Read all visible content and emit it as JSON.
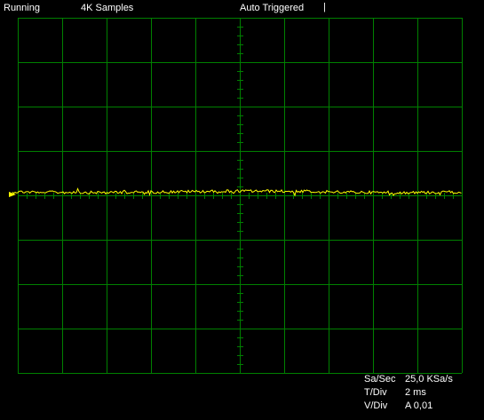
{
  "status_bar": {
    "run_state": "Running",
    "samples": "4K Samples",
    "trigger_mode": "Auto Triggered",
    "trigger_marker": "|"
  },
  "readouts": {
    "sample_rate_label": "Sa/Sec",
    "sample_rate_value": "25,0 KSa/s",
    "time_div_label": "T/Div",
    "time_div_value": "2 ms",
    "volt_div_label": "V/Div",
    "volt_div_value": "A 0,01"
  },
  "colors": {
    "background": "#000000",
    "grid": "#008000",
    "trace": "#ffff00",
    "text": "#ffffff"
  },
  "icons": {
    "trigger_arrow": "trigger-level-arrow-icon"
  }
}
